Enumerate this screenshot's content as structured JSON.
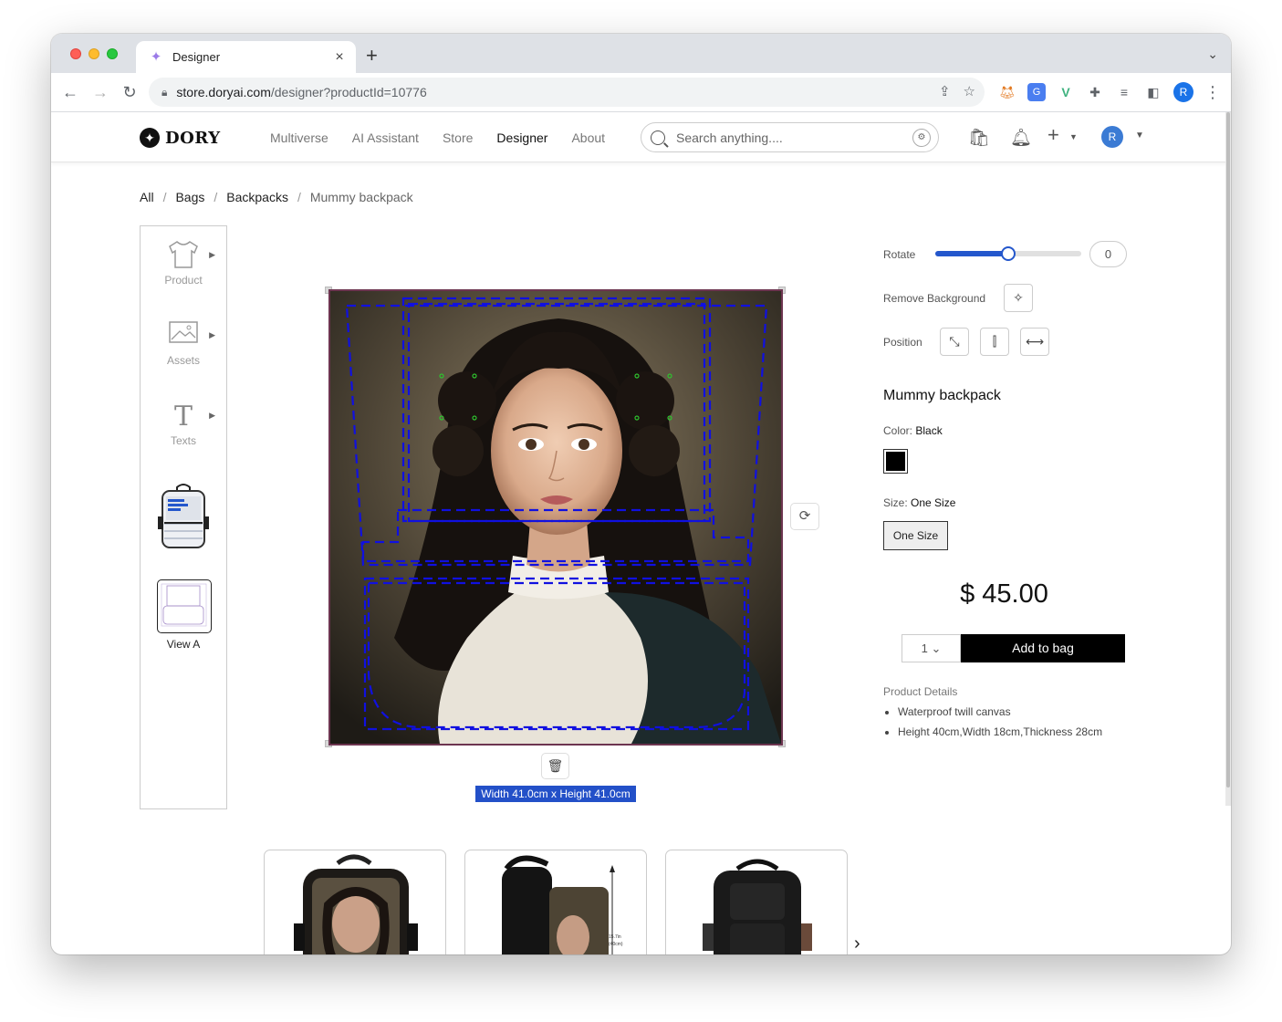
{
  "browser": {
    "tab_title": "Designer",
    "url_host": "store.doryai.com",
    "url_path": "/designer?productId=10776",
    "profile_initial": "R"
  },
  "site": {
    "logo_text": "DORY",
    "nav": [
      {
        "label": "Multiverse"
      },
      {
        "label": "AI Assistant"
      },
      {
        "label": "Store"
      },
      {
        "label": "Designer"
      },
      {
        "label": "About"
      }
    ],
    "search_placeholder": "Search anything....",
    "user_initial": "R"
  },
  "breadcrumb": {
    "items": [
      "All",
      "Bags",
      "Backpacks"
    ],
    "current": "Mummy backpack"
  },
  "tools": {
    "product": "Product",
    "assets": "Assets",
    "texts": "Texts",
    "view_label": "View A"
  },
  "canvas": {
    "dimensions_label": "Width 41.0cm x Height 41.0cm"
  },
  "panel": {
    "rotate_label": "Rotate",
    "rotate_value": "0",
    "rotate_fraction": 0.5,
    "remove_bg_label": "Remove Background",
    "position_label": "Position",
    "product_title": "Mummy backpack",
    "color_label": "Color:",
    "color_value": "Black",
    "color_hex": "#000000",
    "size_label": "Size:",
    "size_value": "One Size",
    "size_button": "One Size",
    "price": "$ 45.00",
    "quantity": "1",
    "add_to_bag": "Add to bag",
    "details_title": "Product Details",
    "details": [
      "Waterproof twill canvas",
      "Height 40cm,Width 18cm,Thickness 28cm"
    ]
  },
  "colors": {
    "accent": "#2457cc",
    "canvas_border": "#6d3550",
    "guide_lines": "#1010e0"
  }
}
